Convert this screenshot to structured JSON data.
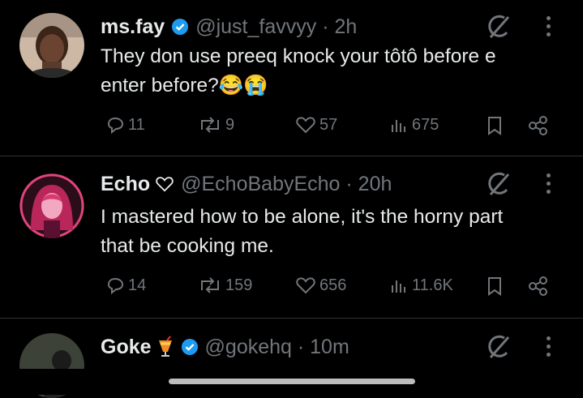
{
  "tweets": [
    {
      "name": "ms.fay",
      "handle": "@just_favvyy · 2h",
      "verified": true,
      "text_lines": [
        "They don use preeq knock your tôtô before e",
        "enter before?😂😭"
      ],
      "replies": "11",
      "reposts": "9",
      "likes": "57",
      "views": "675"
    },
    {
      "name": "Echo",
      "handle": "@EchoBabyEcho · 20h",
      "verified": false,
      "text_lines": [
        "I mastered how to be alone, it's the horny part",
        "that be cooking me."
      ],
      "replies": "14",
      "reposts": "159",
      "likes": "656",
      "views": "11.6K"
    },
    {
      "name": "Goke",
      "handle": "@gokehq · 10m",
      "verified": true
    }
  ],
  "colors": {
    "background": "#000000",
    "text": "#e7e9ea",
    "muted": "#71767b",
    "verified": "#1d9bf0",
    "divider": "#2f3336"
  },
  "icons": [
    "reply-icon",
    "repost-icon",
    "like-icon",
    "views-icon",
    "bookmark-icon",
    "share-icon",
    "grok-icon",
    "more-icon",
    "verified-icon",
    "heart-badge-icon",
    "drink-emoji-icon"
  ]
}
